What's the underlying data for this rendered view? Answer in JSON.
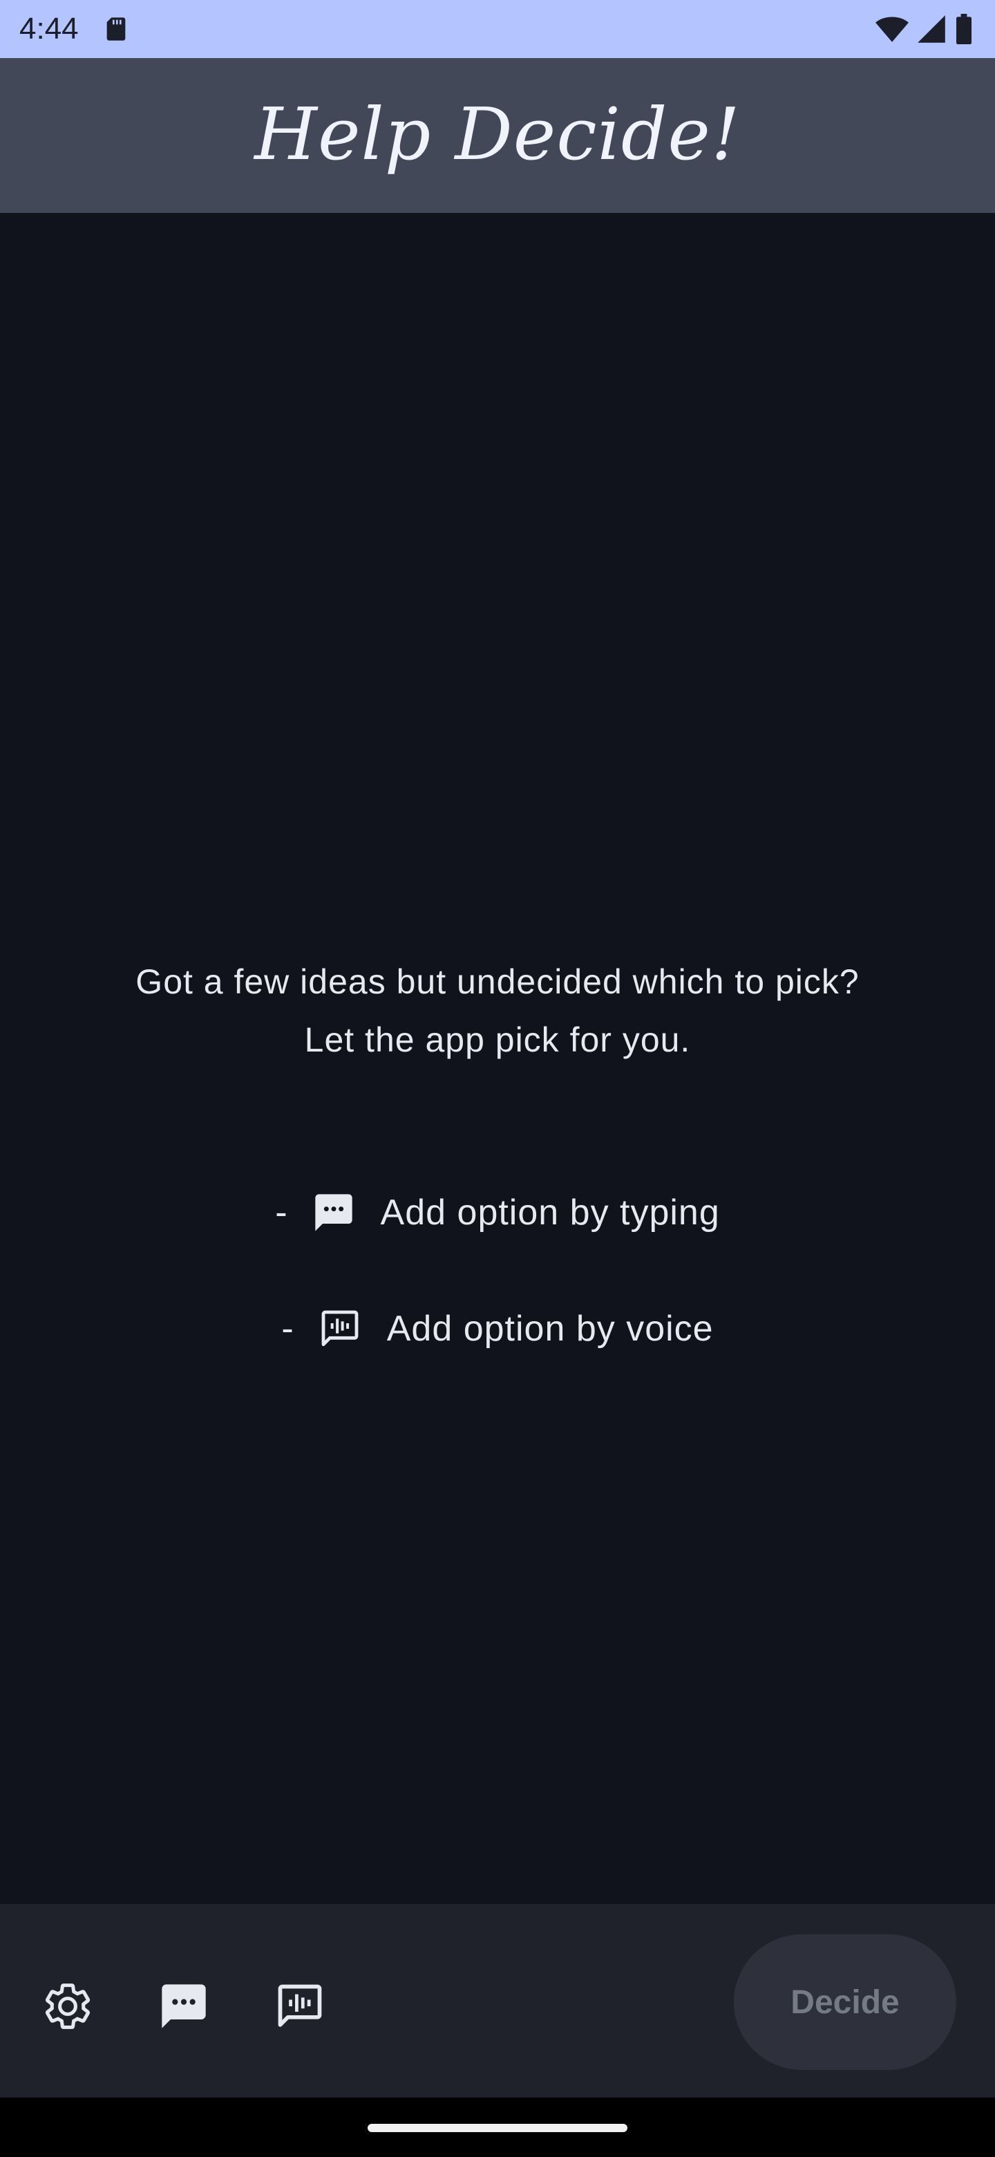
{
  "status_bar": {
    "time": "4:44",
    "icons": [
      "sd-card-icon",
      "wifi-icon",
      "signal-icon",
      "battery-icon"
    ]
  },
  "app_bar": {
    "title": "Help Decide!"
  },
  "main": {
    "intro_line1": "Got a few ideas but undecided which to pick?",
    "intro_line2": "Let the app pick for you.",
    "hints": [
      {
        "dash": "-",
        "icon": "message-dots-icon",
        "label": "Add option by typing"
      },
      {
        "dash": "-",
        "icon": "voice-message-icon",
        "label": "Add option by voice"
      }
    ]
  },
  "bottom_bar": {
    "icons": [
      "settings-icon",
      "message-dots-icon",
      "voice-message-icon"
    ],
    "decide_label": "Decide",
    "decide_enabled": false
  },
  "colors": {
    "status_bar_bg": "#b4c4ff",
    "app_bar_bg": "#434859",
    "background": "#11131c",
    "bottom_bar_bg": "#1f212b",
    "decide_bg": "#2e313c",
    "decide_text": "#767a85",
    "text": "#e7e9f1"
  }
}
